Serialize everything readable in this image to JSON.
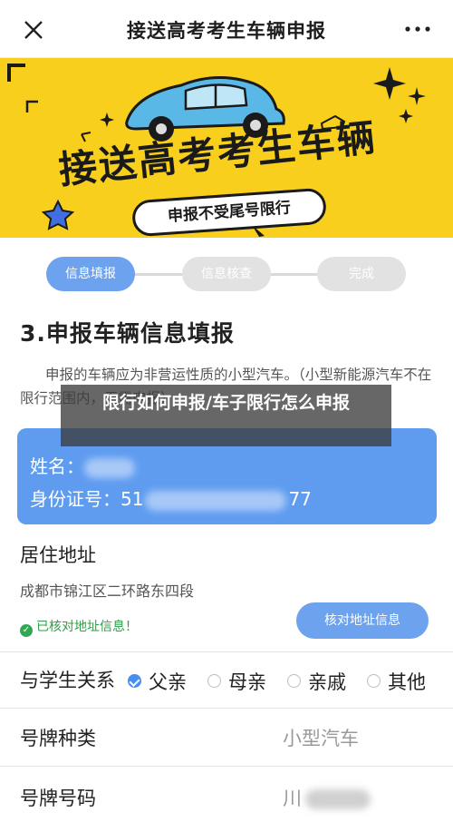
{
  "nav": {
    "title": "接送高考考生车辆申报",
    "close_icon": "close-icon",
    "more_icon": "more-dots-icon"
  },
  "banner": {
    "headline": "接送高考考生车辆",
    "pill": "申报不受尾号限行",
    "background": "#f7cf1c"
  },
  "steps": [
    {
      "label": "信息填报",
      "active": true
    },
    {
      "label": "信息核查",
      "active": false
    },
    {
      "label": "完成",
      "active": false
    }
  ],
  "section": {
    "title": "3.申报车辆信息填报",
    "note": "申报的车辆应为非营运性质的小型汽车。（小型新能源汽车不在限行范围内，无需申报）"
  },
  "caption": {
    "text": "限行如何申报/车子限行怎么申报"
  },
  "card": {
    "name_label": "姓名：",
    "id_label": "身份证号：",
    "id_prefix": "51",
    "id_suffix": "77",
    "color": "#5f9cf0"
  },
  "address": {
    "label": "居住地址",
    "value": "成都市锦江区二环路东四段",
    "verified_text": "已核对地址信息！",
    "verify_button": "核对地址信息"
  },
  "relation": {
    "label": "与学生关系",
    "options": [
      {
        "label": "父亲",
        "checked": true
      },
      {
        "label": "母亲",
        "checked": false
      },
      {
        "label": "亲戚",
        "checked": false
      },
      {
        "label": "其他",
        "checked": false
      }
    ]
  },
  "plate_type": {
    "label": "号牌种类",
    "value": "小型汽车"
  },
  "plate_number": {
    "label": "号牌号码",
    "value": "川"
  },
  "colors": {
    "accent": "#6da2ef",
    "success": "#2f9e46"
  }
}
